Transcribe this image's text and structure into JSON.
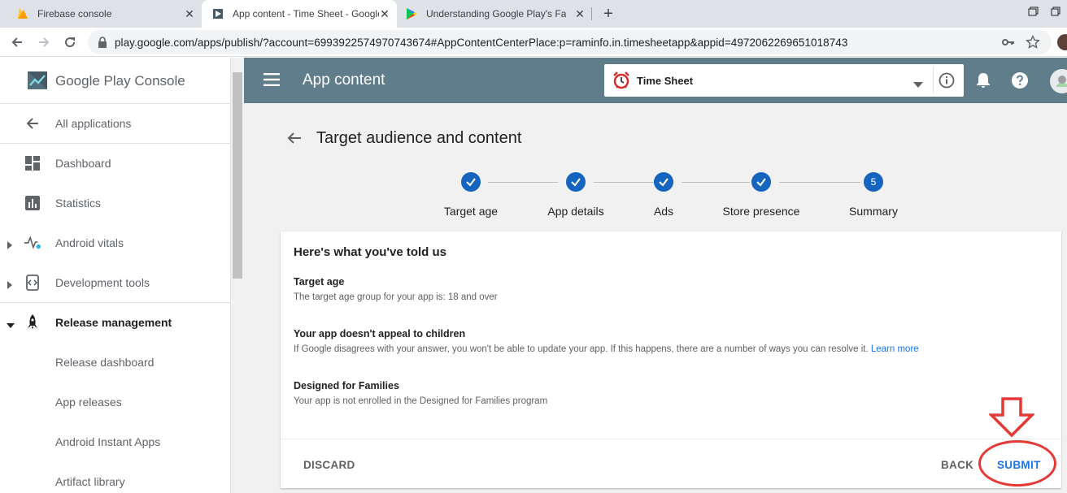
{
  "browser": {
    "tabs": [
      {
        "title": "Firebase console",
        "icon": "firebase-icon",
        "active": false
      },
      {
        "title": "App content - Time Sheet - Google Play Console",
        "icon": "play-console-icon",
        "active": true
      },
      {
        "title": "Understanding Google Play's Families Policy",
        "icon": "google-play-icon",
        "active": false
      }
    ],
    "url": "play.google.com/apps/publish/?account=6993922574970743674#AppContentCenterPlace:p=raminfo.in.timesheetapp&appid=4972062269651018743"
  },
  "sidebar": {
    "brand": "Google Play Console",
    "items": [
      {
        "label": "All applications",
        "icon": "arrow-back-icon"
      },
      {
        "label": "Dashboard",
        "icon": "dashboard-icon"
      },
      {
        "label": "Statistics",
        "icon": "bar-chart-icon"
      },
      {
        "label": "Android vitals",
        "icon": "vitals-pulse-icon"
      },
      {
        "label": "Development tools",
        "icon": "code-icon"
      },
      {
        "label": "Release management",
        "icon": "rocket-icon"
      },
      {
        "label": "Release dashboard",
        "icon": ""
      },
      {
        "label": "App releases",
        "icon": ""
      },
      {
        "label": "Android Instant Apps",
        "icon": ""
      },
      {
        "label": "Artifact library",
        "icon": ""
      }
    ]
  },
  "topbar": {
    "title": "App content",
    "app_name": "Time Sheet"
  },
  "main": {
    "section_title": "Target audience and content",
    "steps": [
      {
        "label": "Target age",
        "state": "done"
      },
      {
        "label": "App details",
        "state": "done"
      },
      {
        "label": "Ads",
        "state": "done"
      },
      {
        "label": "Store presence",
        "state": "done"
      },
      {
        "label": "Summary",
        "state": "current",
        "number": "5"
      }
    ],
    "card": {
      "title": "Here's what you've told us",
      "sections": [
        {
          "heading": "Target age",
          "body": "The target age group for your app is: 18 and over"
        },
        {
          "heading": "Your app doesn't appeal to children",
          "body": "If Google disagrees with your answer, you won't be able to update your app. If this happens, there are a number of ways you can resolve it.",
          "link": "Learn more"
        },
        {
          "heading": "Designed for Families",
          "body": "Your app is not enrolled in the Designed for Families program"
        }
      ],
      "buttons": {
        "discard": "DISCARD",
        "back": "BACK",
        "submit": "SUBMIT"
      }
    }
  },
  "colors": {
    "topbar": "#607d8b",
    "accent": "#1a73e8",
    "annotation": "#e53935"
  }
}
